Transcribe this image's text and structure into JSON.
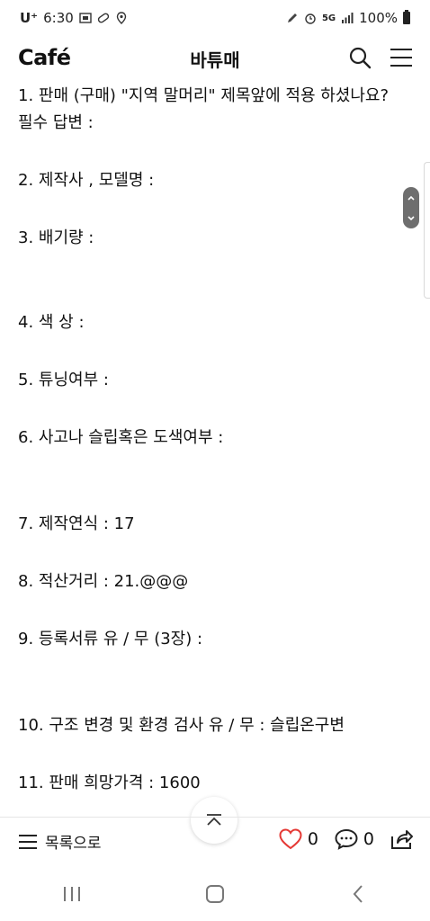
{
  "status_bar": {
    "carrier": "U⁺",
    "time": "6:30",
    "network": "5G",
    "battery": "100%"
  },
  "header": {
    "brand": "Café",
    "title": "바튜매"
  },
  "content": {
    "lines": [
      "1. 판매 (구매) \"지역 말머리\" 제목앞에 적용 하셨나요?",
      "필수 답변 :",
      "2. 제작사 , 모델명 :",
      "3. 배기량 :",
      "4. 색 상 :",
      "5. 튜닝여부 :",
      "6. 사고나 슬립혹은 도색여부 :",
      "7. 제작연식 : 17",
      "8. 적산거리 : 21.@@@",
      "9. 등록서류 유 / 무 (3장) :",
      "10. 구조 변경 및 환경 검사 유 / 무 : 슬립온구변",
      "11. 판매 희망가격 : 1600"
    ]
  },
  "bottom_bar": {
    "list_label": "목록으로",
    "like_count": "0",
    "comment_count": "0"
  },
  "icons": {
    "search": "search-icon",
    "menu": "menu-icon",
    "heart": "heart-icon",
    "comment": "comment-icon",
    "share": "share-icon",
    "top": "chevron-up-icon"
  },
  "colors": {
    "like_red": "#e53935",
    "text": "#111111",
    "divider": "#e6e6e6"
  }
}
